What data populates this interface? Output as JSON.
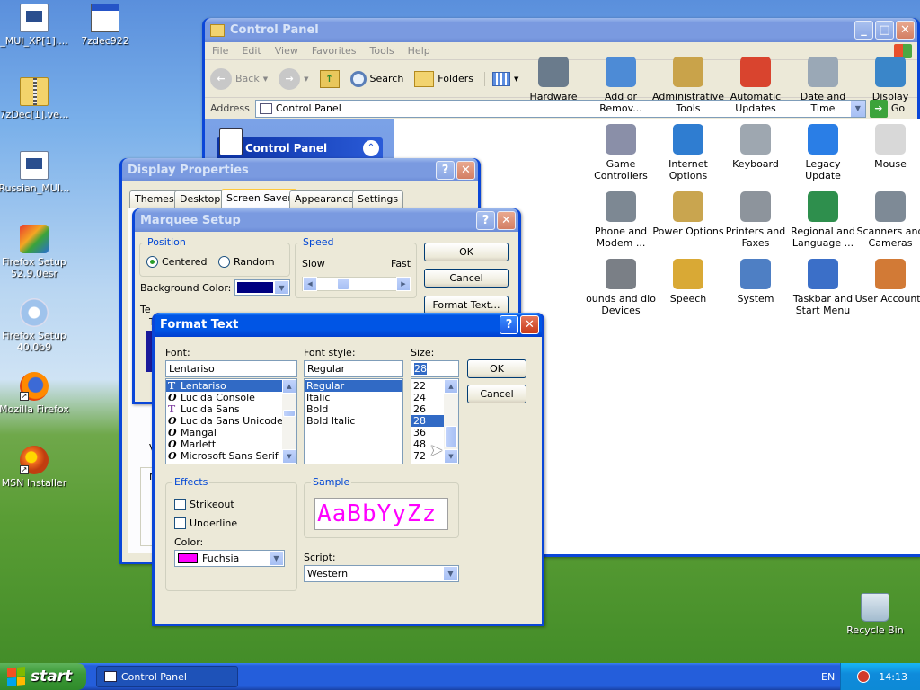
{
  "desktop": {
    "icons": [
      {
        "label": "_MUI_XP[1]....",
        "icon": "document-icon"
      },
      {
        "label": "7zdec922",
        "icon": "window-icon"
      },
      {
        "label": "7zDec[1].ve...",
        "icon": "zip-folder-icon"
      },
      {
        "label": "Russian_MUI...",
        "icon": "document-icon"
      },
      {
        "label": "Firefox Setup 52.9.0esr",
        "icon": "setup-icon"
      },
      {
        "label": "Firefox Setup 40.0b9",
        "icon": "setup-icon"
      },
      {
        "label": "Mozilla Firefox",
        "icon": "firefox-icon"
      },
      {
        "label": "MSN Installer",
        "icon": "msn-icon"
      },
      {
        "label": "Recycle Bin",
        "icon": "recycle-bin-icon"
      }
    ]
  },
  "control_panel": {
    "title": "Control Panel",
    "menu": [
      "File",
      "Edit",
      "View",
      "Favorites",
      "Tools",
      "Help"
    ],
    "toolbar": {
      "back": "Back",
      "search": "Search",
      "folders": "Folders"
    },
    "address_label": "Address",
    "address_value": "Control Panel",
    "go_label": "Go",
    "sidebar_title": "Control Panel",
    "items": [
      {
        "label": "Hardware",
        "color": "#6a7b8c"
      },
      {
        "label": "Add or Remov...",
        "color": "#4d8bd6"
      },
      {
        "label": "Administrative Tools",
        "color": "#c9a34a"
      },
      {
        "label": "Automatic Updates",
        "color": "#d9442e"
      },
      {
        "label": "Date and Time",
        "color": "#9aa8b6"
      },
      {
        "label": "Display",
        "color": "#3a86c9"
      },
      {
        "label": "Game Controllers",
        "color": "#8a8fa8"
      },
      {
        "label": "Internet Options",
        "color": "#2f7dd1"
      },
      {
        "label": "Keyboard",
        "color": "#9ea7b0"
      },
      {
        "label": "Legacy Update",
        "color": "#2a7ee6"
      },
      {
        "label": "Mouse",
        "color": "#d8d8d8"
      },
      {
        "label": "Phone and Modem ...",
        "color": "#7d8893"
      },
      {
        "label": "Power Options",
        "color": "#c9a54f"
      },
      {
        "label": "Printers and Faxes",
        "color": "#8d949c"
      },
      {
        "label": "Regional and Language ...",
        "color": "#2e8f4d"
      },
      {
        "label": "Scanners and Cameras",
        "color": "#7e8a96"
      },
      {
        "label": "ounds and dio Devices",
        "color": "#7a7f86"
      },
      {
        "label": "Speech",
        "color": "#d9a935"
      },
      {
        "label": "System",
        "color": "#4e7fc4"
      },
      {
        "label": "Taskbar and Start Menu",
        "color": "#3b6fc8"
      },
      {
        "label": "User Accounts",
        "color": "#d27a36"
      }
    ]
  },
  "display_properties": {
    "title": "Display Properties",
    "tabs": [
      "Themes",
      "Desktop",
      "Screen Saver",
      "Appearance",
      "Settings"
    ],
    "selected_tab": "Screen Saver"
  },
  "marquee_setup": {
    "title": "Marquee Setup",
    "position_label": "Position",
    "centered_label": "Centered",
    "random_label": "Random",
    "speed_label": "Speed",
    "slow_label": "Slow",
    "fast_label": "Fast",
    "speed_level": 0.3,
    "bg_color_label": "Background Color:",
    "bg_color": "#000080",
    "ok": "OK",
    "cancel": "Cancel",
    "format_text": "Format Text...",
    "partial_labels": [
      "Te",
      "T",
      "V",
      "N"
    ]
  },
  "format_text": {
    "title": "Format Text",
    "font_label": "Font:",
    "font_value": "Lentariso",
    "fonts": [
      {
        "name": "Lentariso",
        "type": "tt",
        "selected": true
      },
      {
        "name": "Lucida Console",
        "type": "o",
        "selected": false
      },
      {
        "name": "Lucida Sans",
        "type": "tt",
        "selected": false
      },
      {
        "name": "Lucida Sans Unicode",
        "type": "o",
        "selected": false
      },
      {
        "name": "Mangal",
        "type": "o",
        "selected": false
      },
      {
        "name": "Marlett",
        "type": "o",
        "selected": false
      },
      {
        "name": "Microsoft Sans Serif",
        "type": "o",
        "selected": false
      }
    ],
    "style_label": "Font style:",
    "style_value": "Regular",
    "styles": [
      "Regular",
      "Italic",
      "Bold",
      "Bold Italic"
    ],
    "size_label": "Size:",
    "size_value": "28",
    "sizes": [
      "22",
      "24",
      "26",
      "28",
      "36",
      "48",
      "72"
    ],
    "selected_size": "28",
    "ok": "OK",
    "cancel": "Cancel",
    "effects_label": "Effects",
    "strikeout_label": "Strikeout",
    "underline_label": "Underline",
    "color_label": "Color:",
    "color_value": "Fuchsia",
    "color_swatch": "#ff00ff",
    "sample_label": "Sample",
    "sample_text": "AaBbYyZz",
    "script_label": "Script:",
    "script_value": "Western"
  },
  "taskbar": {
    "start": "start",
    "task": "Control Panel",
    "language": "EN",
    "clock": "14:13"
  }
}
